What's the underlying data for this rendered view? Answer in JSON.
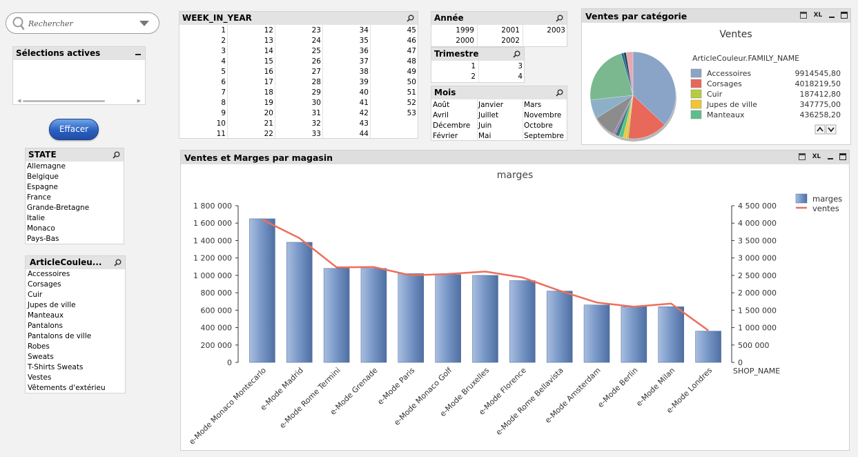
{
  "search": {
    "placeholder": "Rechercher"
  },
  "active_selections": {
    "title": "Sélections actives"
  },
  "clear_button": {
    "label": "Effacer"
  },
  "state_list": {
    "title": "STATE",
    "items": [
      "Allemagne",
      "Belgique",
      "Espagne",
      "France",
      "Grande-Bretagne",
      "Italie",
      "Monaco",
      "Pays-Bas"
    ]
  },
  "article_list": {
    "title": "ArticleCouleu...",
    "items": [
      "Accessoires",
      "Corsages",
      "Cuir",
      "Jupes de ville",
      "Manteaux",
      "Pantalons",
      "Pantalons de ville",
      "Robes",
      "Sweats",
      "T-Shirts Sweats",
      "Vestes",
      "Vêtements d'extérieu"
    ]
  },
  "week_list": {
    "title": "WEEK_IN_YEAR",
    "columns": [
      [
        "1",
        "2",
        "3",
        "4",
        "5",
        "6",
        "7",
        "8",
        "9",
        "10",
        "11"
      ],
      [
        "12",
        "13",
        "14",
        "15",
        "16",
        "17",
        "18",
        "19",
        "20",
        "21",
        "22"
      ],
      [
        "23",
        "24",
        "25",
        "26",
        "27",
        "28",
        "29",
        "30",
        "31",
        "32",
        "33"
      ],
      [
        "34",
        "35",
        "36",
        "37",
        "38",
        "39",
        "40",
        "41",
        "42",
        "43",
        "44"
      ],
      [
        "45",
        "46",
        "47",
        "48",
        "49",
        "50",
        "51",
        "52",
        "53"
      ]
    ]
  },
  "year_list": {
    "title": "Année",
    "rows": [
      [
        "1999",
        "2001",
        "2003"
      ],
      [
        "2000",
        "2002",
        ""
      ]
    ]
  },
  "quarter_list": {
    "title": "Trimestre",
    "rows": [
      [
        "1",
        "3"
      ],
      [
        "2",
        "4"
      ]
    ]
  },
  "month_list": {
    "title": "Mois",
    "rows": [
      [
        "Août",
        "Janvier",
        "Mars"
      ],
      [
        "Avril",
        "Juillet",
        "Novembre"
      ],
      [
        "Décembre",
        "Juin",
        "Octobre"
      ],
      [
        "Février",
        "Mai",
        "Septembre"
      ]
    ]
  },
  "pie_panel": {
    "title": "Ventes par catégorie",
    "xl_label": "XL",
    "chart_data": {
      "type": "pie",
      "title": "Ventes",
      "legend_title": "ArticleCouleur.FAMILY_NAME",
      "legend": [
        {
          "label": "Accessoires",
          "value_text": "9914545,80",
          "value": 9914545.8,
          "color": "#8aa4c8"
        },
        {
          "label": "Corsages",
          "value_text": "4018219,50",
          "value": 4018219.5,
          "color": "#e8685a"
        },
        {
          "label": "Cuir",
          "value_text": "187412,80",
          "value": 187412.8,
          "color": "#b5cc3e"
        },
        {
          "label": "Jupes de ville",
          "value_text": "347775,00",
          "value": 347775.0,
          "color": "#f2c534"
        },
        {
          "label": "Manteaux",
          "value_text": "436258,20",
          "value": 436258.2,
          "color": "#5cbf8b"
        }
      ],
      "unlisted_slices": [
        {
          "value": 380000,
          "color": "#2d7c73"
        },
        {
          "value": 250000,
          "color": "#a874b8"
        },
        {
          "value": 2300000,
          "color": "#8c8c8c"
        },
        {
          "value": 1900000,
          "color": "#8cb0c8"
        },
        {
          "value": 6000000,
          "color": "#7bb88f"
        },
        {
          "value": 250000,
          "color": "#1f6a8c"
        },
        {
          "value": 250000,
          "color": "#1e3f57"
        },
        {
          "value": 700000,
          "color": "#e6a8b4"
        }
      ]
    }
  },
  "bar_panel": {
    "title": "Ventes et Marges par magasin",
    "xl_label": "XL",
    "chart_data": {
      "type": "bar",
      "title": "marges",
      "xlabel": "SHOP_NAME",
      "categories": [
        "e-Mode Monaco Montecarlo",
        "e-Mode Madrid",
        "e-Mode Rome Termini",
        "e-Mode Grenade",
        "e-Mode Paris",
        "e-Mode Monaco Golf",
        "e-Mode Bruxelles",
        "e-Mode Florence",
        "e-Mode Rome Bellavista",
        "e-Mode Amsterdam",
        "e-Mode Berlin",
        "e-Mode Milan",
        "e-Mode Londres"
      ],
      "series": [
        {
          "name": "marges",
          "type": "bar",
          "axis": "left",
          "color": "#6f8fbf",
          "values": [
            1650000,
            1380000,
            1080000,
            1080000,
            1020000,
            1010000,
            1000000,
            940000,
            820000,
            660000,
            640000,
            640000,
            360000
          ]
        },
        {
          "name": "ventes",
          "type": "line",
          "axis": "right",
          "color": "#ec6e5c",
          "values": [
            4100000,
            3570000,
            2730000,
            2740000,
            2500000,
            2540000,
            2610000,
            2440000,
            2060000,
            1720000,
            1600000,
            1690000,
            920000
          ]
        }
      ],
      "left_axis": {
        "ylim": [
          0,
          1800000
        ],
        "ticks": [
          "0",
          "200 000",
          "400 000",
          "600 000",
          "800 000",
          "1 000 000",
          "1 200 000",
          "1 400 000",
          "1 600 000",
          "1 800 000"
        ]
      },
      "right_axis": {
        "ylim": [
          0,
          4500000
        ],
        "ticks": [
          "0",
          "500 000",
          "1 000 000",
          "1 500 000",
          "2 000 000",
          "2 500 000",
          "3 000 000",
          "3 500 000",
          "4 000 000",
          "4 500 000"
        ]
      },
      "legend_position": "top-right"
    }
  }
}
